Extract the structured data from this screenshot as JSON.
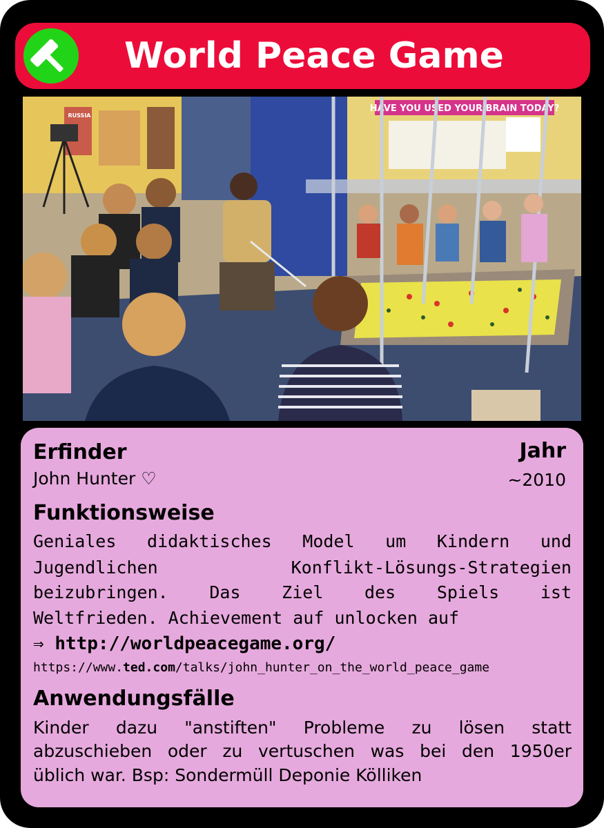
{
  "card": {
    "title": "World Peace Game",
    "icon": "hammer-icon",
    "colors": {
      "header": "#ec0c3a",
      "icon_bg": "#22d418",
      "panel": "#e6a9dd",
      "frame": "#000000"
    }
  },
  "photo": {
    "banner_text": "HAVE YOU USED YOUR BRAIN TODAY?",
    "poster_text": "RUSSIA"
  },
  "inventor": {
    "heading": "Erfinder",
    "name": "John Hunter ♡"
  },
  "year": {
    "heading": "Jahr",
    "value": "~2010"
  },
  "function": {
    "heading": "Funktionsweise",
    "lines": [
      "Geniales didaktisches Model um Kindern und",
      "Jugendlichen Konflikt-Lösungs-Strategien",
      "beizubringen. Das Ziel des Spiels ist",
      "Weltfrieden. Achievement auf unlocken auf"
    ],
    "arrow": "⇒",
    "link": "http://worldpeacegame.org/",
    "ted_prefix": "https://www.",
    "ted_domain": "ted.com",
    "ted_path": "/talks/john_hunter_on_the_world_peace_game"
  },
  "use_cases": {
    "heading": "Anwendungsfälle",
    "lines": [
      "Kinder dazu \"anstiften\" Probleme zu lösen statt",
      "abzuschieben oder zu vertuschen was bei den 1950er",
      "üblich war. Bsp: Sondermüll Deponie Kölliken"
    ]
  }
}
